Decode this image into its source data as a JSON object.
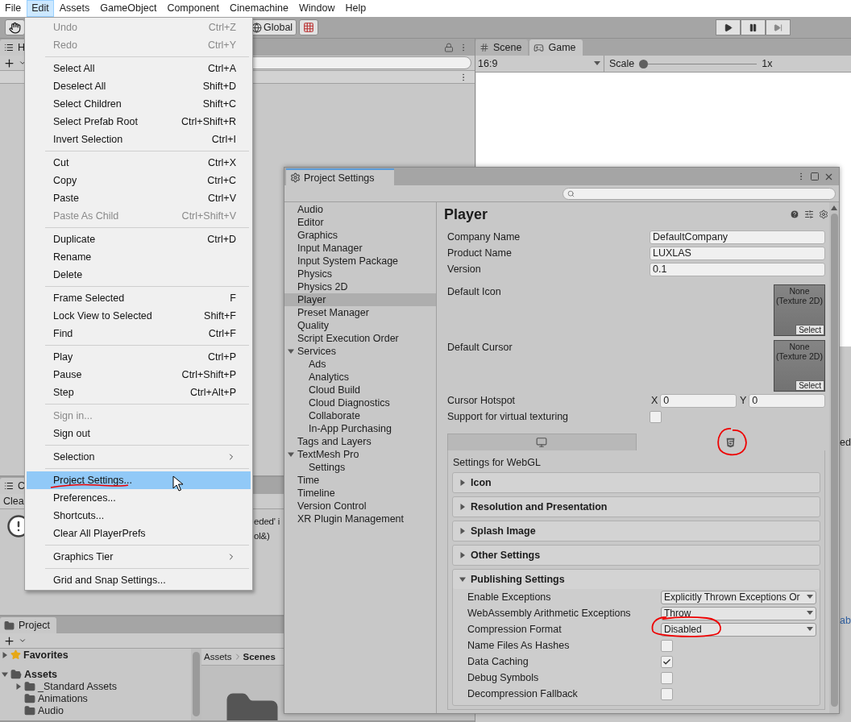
{
  "menubar": [
    {
      "label": "File",
      "selected": false
    },
    {
      "label": "Edit",
      "selected": true
    },
    {
      "label": "Assets",
      "selected": false
    },
    {
      "label": "GameObject",
      "selected": false
    },
    {
      "label": "Component",
      "selected": false
    },
    {
      "label": "Cinemachine",
      "selected": false
    },
    {
      "label": "Window",
      "selected": false
    },
    {
      "label": "Help",
      "selected": false
    }
  ],
  "toolbar": {
    "global_label": "Global"
  },
  "hierarchy": {
    "tab": "H"
  },
  "console": {
    "tab": "C",
    "clear": "Clea",
    "lines": [
      "eded' i",
      "ol&)"
    ]
  },
  "project": {
    "tab": "Project",
    "tree": [
      {
        "label": "Favorites",
        "expanded": false,
        "kind": "favorites"
      },
      {
        "label": "Assets",
        "expanded": true,
        "kind": "folder",
        "children": [
          {
            "label": "_Standard Assets",
            "expanded": false,
            "kind": "folder"
          },
          {
            "label": "Animations",
            "kind": "folder"
          },
          {
            "label": "Audio",
            "kind": "folder"
          }
        ]
      }
    ],
    "breadcrumb": [
      "Assets",
      "Scenes"
    ]
  },
  "view_tabs": [
    {
      "label": "Scene",
      "kind": "scene",
      "selected": false
    },
    {
      "label": "Game",
      "kind": "game",
      "selected": true
    }
  ],
  "game_bar": {
    "aspect": "16:9",
    "scale_label": "Scale",
    "level": 0,
    "scale_value": "1x"
  },
  "edge_texts": [
    "ed",
    "ab"
  ],
  "edit_menu": [
    {
      "kind": "item",
      "label": "Undo",
      "shortcut": "Ctrl+Z",
      "disabled": true,
      "selected": false
    },
    {
      "kind": "item",
      "label": "Redo",
      "shortcut": "Ctrl+Y",
      "disabled": true,
      "selected": false
    },
    {
      "kind": "separator"
    },
    {
      "kind": "item",
      "label": "Select All",
      "shortcut": "Ctrl+A",
      "disabled": false,
      "selected": false
    },
    {
      "kind": "item",
      "label": "Deselect All",
      "shortcut": "Shift+D",
      "disabled": false,
      "selected": false
    },
    {
      "kind": "item",
      "label": "Select Children",
      "shortcut": "Shift+C",
      "disabled": false,
      "selected": false
    },
    {
      "kind": "item",
      "label": "Select Prefab Root",
      "shortcut": "Ctrl+Shift+R",
      "disabled": false,
      "selected": false
    },
    {
      "kind": "item",
      "label": "Invert Selection",
      "shortcut": "Ctrl+I",
      "disabled": false,
      "selected": false
    },
    {
      "kind": "separator"
    },
    {
      "kind": "item",
      "label": "Cut",
      "shortcut": "Ctrl+X",
      "disabled": false,
      "selected": false
    },
    {
      "kind": "item",
      "label": "Copy",
      "shortcut": "Ctrl+C",
      "disabled": false,
      "selected": false
    },
    {
      "kind": "item",
      "label": "Paste",
      "shortcut": "Ctrl+V",
      "disabled": false,
      "selected": false
    },
    {
      "kind": "item",
      "label": "Paste As Child",
      "shortcut": "Ctrl+Shift+V",
      "disabled": true,
      "selected": false
    },
    {
      "kind": "separator"
    },
    {
      "kind": "item",
      "label": "Duplicate",
      "shortcut": "Ctrl+D",
      "disabled": false,
      "selected": false
    },
    {
      "kind": "item",
      "label": "Rename",
      "disabled": false,
      "selected": false
    },
    {
      "kind": "item",
      "label": "Delete",
      "disabled": false,
      "selected": false
    },
    {
      "kind": "separator"
    },
    {
      "kind": "item",
      "label": "Frame Selected",
      "shortcut": "F",
      "disabled": false,
      "selected": false
    },
    {
      "kind": "item",
      "label": "Lock View to Selected",
      "shortcut": "Shift+F",
      "disabled": false,
      "selected": false
    },
    {
      "kind": "item",
      "label": "Find",
      "shortcut": "Ctrl+F",
      "disabled": false,
      "selected": false
    },
    {
      "kind": "separator"
    },
    {
      "kind": "item",
      "label": "Play",
      "shortcut": "Ctrl+P",
      "disabled": false,
      "selected": false
    },
    {
      "kind": "item",
      "label": "Pause",
      "shortcut": "Ctrl+Shift+P",
      "disabled": false,
      "selected": false
    },
    {
      "kind": "item",
      "label": "Step",
      "shortcut": "Ctrl+Alt+P",
      "disabled": false,
      "selected": false
    },
    {
      "kind": "separator"
    },
    {
      "kind": "item",
      "label": "Sign in...",
      "disabled": true,
      "selected": false
    },
    {
      "kind": "item",
      "label": "Sign out",
      "disabled": false,
      "selected": false
    },
    {
      "kind": "separator"
    },
    {
      "kind": "submenu",
      "label": "Selection",
      "disabled": false,
      "selected": false
    },
    {
      "kind": "separator"
    },
    {
      "kind": "item",
      "label": "Project Settings...",
      "disabled": false,
      "selected": true
    },
    {
      "kind": "item",
      "label": "Preferences...",
      "disabled": false,
      "selected": false
    },
    {
      "kind": "item",
      "label": "Shortcuts...",
      "disabled": false,
      "selected": false
    },
    {
      "kind": "item",
      "label": "Clear All PlayerPrefs",
      "disabled": false,
      "selected": false
    },
    {
      "kind": "separator"
    },
    {
      "kind": "submenu",
      "label": "Graphics Tier",
      "disabled": false,
      "selected": false
    },
    {
      "kind": "separator"
    },
    {
      "kind": "item",
      "label": "Grid and Snap Settings...",
      "disabled": false,
      "selected": false
    }
  ],
  "project_settings": {
    "tab": "Project Settings",
    "categories": [
      {
        "label": "Audio",
        "selected": false
      },
      {
        "label": "Editor",
        "selected": false
      },
      {
        "label": "Graphics",
        "selected": false
      },
      {
        "label": "Input Manager",
        "selected": false
      },
      {
        "label": "Input System Package",
        "selected": false
      },
      {
        "label": "Physics",
        "selected": false
      },
      {
        "label": "Physics 2D",
        "selected": false
      },
      {
        "label": "Player",
        "selected": true
      },
      {
        "label": "Preset Manager",
        "selected": false
      },
      {
        "label": "Quality",
        "selected": false
      },
      {
        "label": "Script Execution Order",
        "selected": false
      },
      {
        "label": "Services",
        "selected": false,
        "expanded": true,
        "children": [
          {
            "label": "Ads",
            "selected": false
          },
          {
            "label": "Analytics",
            "selected": false
          },
          {
            "label": "Cloud Build",
            "selected": false
          },
          {
            "label": "Cloud Diagnostics",
            "selected": false
          },
          {
            "label": "Collaborate",
            "selected": false
          },
          {
            "label": "In-App Purchasing",
            "selected": false
          }
        ]
      },
      {
        "label": "Tags and Layers",
        "selected": false
      },
      {
        "label": "TextMesh Pro",
        "selected": false,
        "expanded": true,
        "children": [
          {
            "label": "Settings",
            "selected": false
          }
        ]
      },
      {
        "label": "Time",
        "selected": false
      },
      {
        "label": "Timeline",
        "selected": false
      },
      {
        "label": "Version Control",
        "selected": false
      },
      {
        "label": "XR Plugin Management",
        "selected": false
      }
    ],
    "page_title": "Player",
    "fields": [
      {
        "kind": "text",
        "label": "Company Name",
        "value": "DefaultCompany"
      },
      {
        "kind": "text",
        "label": "Product Name",
        "value": "LUXLAS"
      },
      {
        "kind": "text",
        "label": "Version",
        "value": "0.1"
      },
      {
        "kind": "texture",
        "label": "Default Icon",
        "lines": [
          "None",
          "(Texture 2D)"
        ],
        "button": "Select"
      },
      {
        "kind": "texture",
        "label": "Default Cursor",
        "lines": [
          "None",
          "(Texture 2D)"
        ],
        "button": "Select"
      },
      {
        "kind": "vector",
        "label": "Cursor Hotspot",
        "components": [
          {
            "axis": "X",
            "value": "0"
          },
          {
            "axis": "Y",
            "value": "0"
          }
        ]
      },
      {
        "kind": "checkbox",
        "label": "Support for virtual texturing",
        "checked": false
      }
    ],
    "platform_tabs": [
      {
        "kind": "desktop",
        "selected": false
      },
      {
        "kind": "webgl",
        "selected": true
      }
    ],
    "platform_heading": "Settings for WebGL",
    "sections": [
      {
        "label": "Icon",
        "expanded": false
      },
      {
        "label": "Resolution and Presentation",
        "expanded": false
      },
      {
        "label": "Splash Image",
        "expanded": false
      },
      {
        "label": "Other Settings",
        "expanded": false
      },
      {
        "label": "Publishing Settings",
        "expanded": true,
        "rows": [
          {
            "kind": "dropdown",
            "label": "Enable Exceptions",
            "value": "Explicitly Thrown Exceptions Or"
          },
          {
            "kind": "dropdown",
            "label": "WebAssembly Arithmetic Exceptions",
            "value": "Throw"
          },
          {
            "kind": "dropdown",
            "label": "Compression Format",
            "value": "Disabled"
          },
          {
            "kind": "checkbox",
            "label": "Name Files As Hashes",
            "checked": false
          },
          {
            "kind": "checkbox",
            "label": "Data Caching",
            "checked": true
          },
          {
            "kind": "checkbox",
            "label": "Debug Symbols",
            "checked": false
          },
          {
            "kind": "checkbox",
            "label": "Decompression Fallback",
            "checked": false
          }
        ]
      }
    ]
  }
}
